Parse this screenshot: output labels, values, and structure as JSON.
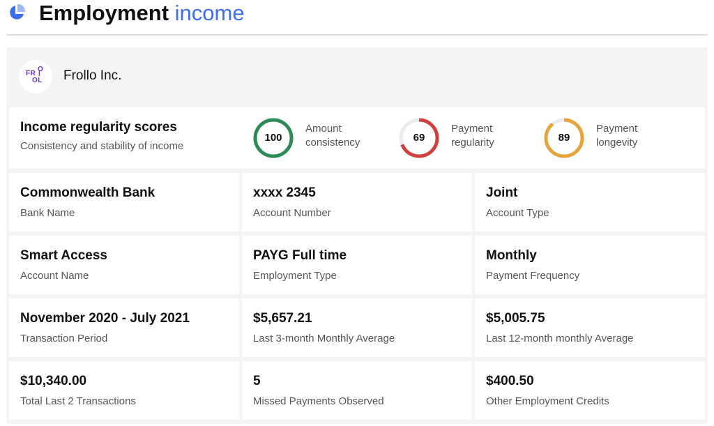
{
  "header": {
    "title_main": "Employment",
    "title_accent": "income",
    "icon": "pie-chart-icon",
    "accent_color": "#3b6ff0"
  },
  "company": {
    "name": "Frollo Inc.",
    "logo": "frollo-logo"
  },
  "scores": {
    "title": "Income regularity scores",
    "subtitle": "Consistency and stability of income",
    "items": [
      {
        "value": "100",
        "fraction": 1.0,
        "label_line1": "Amount",
        "label_line2": "consistency",
        "color": "#2e8b57"
      },
      {
        "value": "69",
        "fraction": 0.69,
        "label_line1": "Payment",
        "label_line2": "regularity",
        "color": "#d0413d"
      },
      {
        "value": "89",
        "fraction": 0.89,
        "label_line1": "Payment",
        "label_line2": "longevity",
        "color": "#e6a53a"
      }
    ]
  },
  "details": [
    {
      "value": "Commonwealth Bank",
      "label": "Bank Name"
    },
    {
      "value": "xxxx 2345",
      "label": "Account Number"
    },
    {
      "value": "Joint",
      "label": "Account Type"
    },
    {
      "value": "Smart Access",
      "label": "Account Name"
    },
    {
      "value": "PAYG Full time",
      "label": "Employment Type"
    },
    {
      "value": "Monthly",
      "label": "Payment Frequency"
    },
    {
      "value": "November 2020 - July 2021",
      "label": "Transaction Period"
    },
    {
      "value": "$5,657.21",
      "label": "Last 3-month Monthly Average"
    },
    {
      "value": "$5,005.75",
      "label": "Last 12-month monthly Average"
    },
    {
      "value": "$10,340.00",
      "label": "Total Last 2 Transactions"
    },
    {
      "value": "5",
      "label": "Missed Payments Observed"
    },
    {
      "value": "$400.50",
      "label": "Other Employment Credits"
    }
  ]
}
